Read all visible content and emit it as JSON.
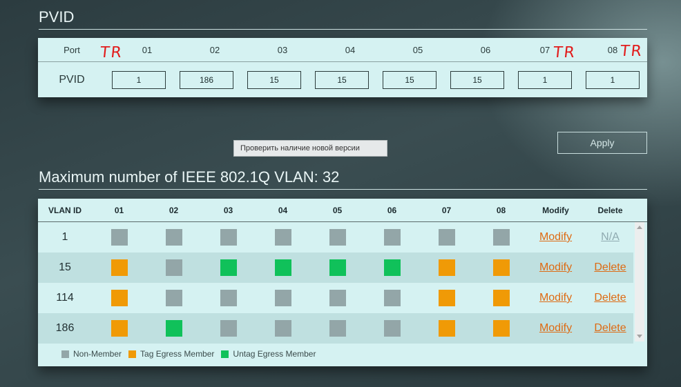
{
  "pvid": {
    "title": "PVID",
    "header_label": "Port",
    "row_label": "PVID",
    "ports": [
      "01",
      "02",
      "03",
      "04",
      "05",
      "06",
      "07",
      "08"
    ],
    "values": [
      "1",
      "186",
      "15",
      "15",
      "15",
      "15",
      "1",
      "1"
    ],
    "annotation": "TR"
  },
  "tooltip": {
    "text": "Проверить наличие новой версии"
  },
  "apply": {
    "label": "Apply"
  },
  "vlan": {
    "title": "Maximum number of IEEE 802.1Q VLAN: 32",
    "columns": [
      "VLAN ID",
      "01",
      "02",
      "03",
      "04",
      "05",
      "06",
      "07",
      "08",
      "Modify",
      "Delete"
    ],
    "rows": [
      {
        "id": "1",
        "ports": [
          "non",
          "non",
          "non",
          "non",
          "non",
          "non",
          "non",
          "non"
        ],
        "modify": "Modify",
        "delete": "N/A"
      },
      {
        "id": "15",
        "ports": [
          "tag",
          "non",
          "untag",
          "untag",
          "untag",
          "untag",
          "tag",
          "tag"
        ],
        "modify": "Modify",
        "delete": "Delete"
      },
      {
        "id": "114",
        "ports": [
          "tag",
          "non",
          "non",
          "non",
          "non",
          "non",
          "tag",
          "tag"
        ],
        "modify": "Modify",
        "delete": "Delete"
      },
      {
        "id": "186",
        "ports": [
          "tag",
          "untag",
          "non",
          "non",
          "non",
          "non",
          "tag",
          "tag"
        ],
        "modify": "Modify",
        "delete": "Delete"
      }
    ]
  },
  "legend": {
    "non_member": "Non-Member",
    "tag_egress": "Tag Egress Member",
    "untag_egress": "Untag Egress Member"
  },
  "colors": {
    "non": "#93a6a8",
    "tag": "#f09a06",
    "untag": "#10c15a",
    "link": "#de6a12"
  }
}
